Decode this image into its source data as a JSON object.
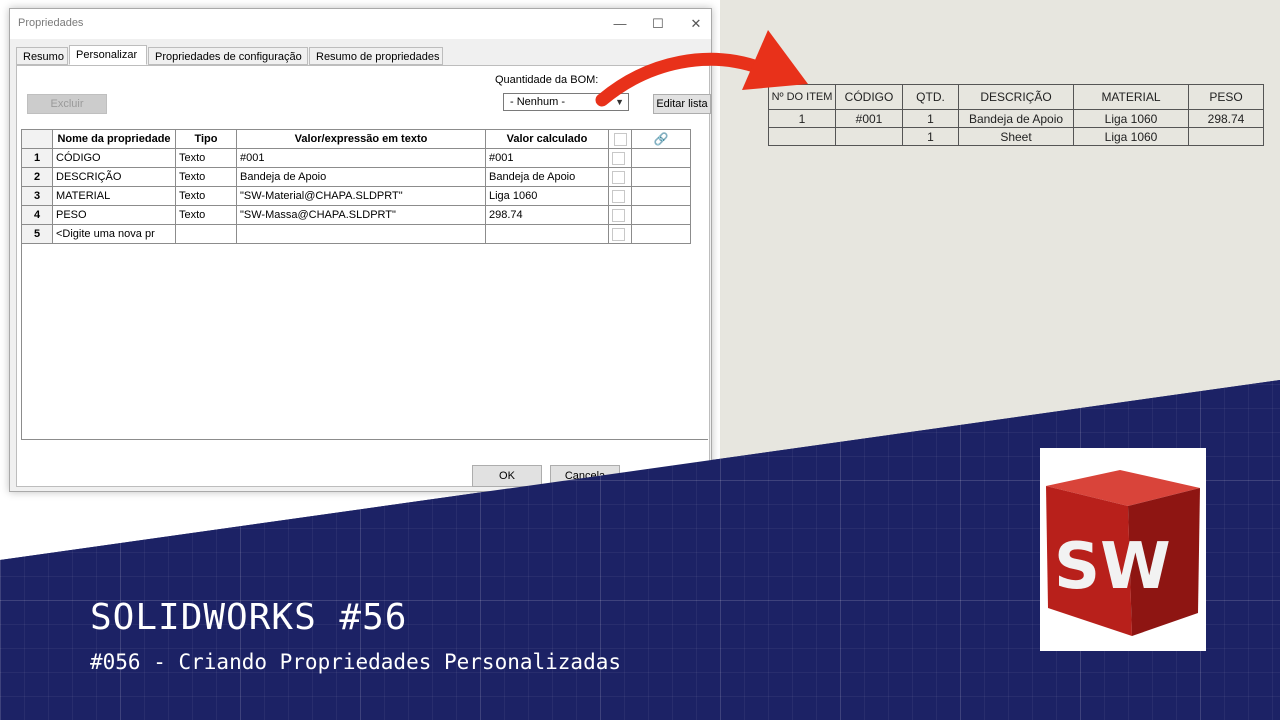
{
  "dialog": {
    "title": "Propriedades",
    "minimize_glyph": "—",
    "maximize_glyph": "☐",
    "close_glyph": "✕",
    "tabs": [
      "Resumo",
      "Personalizar",
      "Propriedades de configuração",
      "Resumo de propriedades"
    ],
    "active_tab": "Personalizar",
    "delete_button": "Excluir",
    "bom_quantity_label": "Quantidade da BOM:",
    "bom_quantity_value": "- Nenhum -",
    "edit_list_button": "Editar lista",
    "ok_button": "OK",
    "cancel_button": "Cancela",
    "table": {
      "headers": [
        "",
        "Nome da propriedade",
        "Tipo",
        "Valor/expressão em texto",
        "Valor calculado",
        "",
        ""
      ],
      "rows": [
        {
          "num": "1",
          "name": "CÓDIGO",
          "type": "Texto",
          "value": "#001",
          "computed": "#001"
        },
        {
          "num": "2",
          "name": "DESCRIÇÃO",
          "type": "Texto",
          "value": "Bandeja de Apoio",
          "computed": "Bandeja de Apoio"
        },
        {
          "num": "3",
          "name": "MATERIAL",
          "type": "Texto",
          "value": "\"SW-Material@CHAPA.SLDPRT\"",
          "computed": "Liga 1060"
        },
        {
          "num": "4",
          "name": "PESO",
          "type": "Texto",
          "value": "\"SW-Massa@CHAPA.SLDPRT\"",
          "computed": "298.74"
        },
        {
          "num": "5",
          "name": "<Digite uma nova pr",
          "type": "",
          "value": "",
          "computed": ""
        }
      ]
    }
  },
  "bom": {
    "headers": [
      "Nº DO ITEM",
      "CÓDIGO",
      "QTD.",
      "DESCRIÇÃO",
      "MATERIAL",
      "PESO"
    ],
    "rows": [
      [
        "1",
        "#001",
        "1",
        "Bandeja de Apoio",
        "Liga 1060",
        "298.74"
      ],
      [
        "",
        "",
        "1",
        "Sheet",
        "Liga 1060",
        ""
      ]
    ]
  },
  "logo": {
    "text": "SW"
  },
  "video": {
    "title": "SOLIDWORKS #56",
    "subtitle": "#056 - Criando Propriedades Personalizadas"
  },
  "colors": {
    "accent_red": "#e8311a",
    "banner_blue": "#1c2265"
  }
}
